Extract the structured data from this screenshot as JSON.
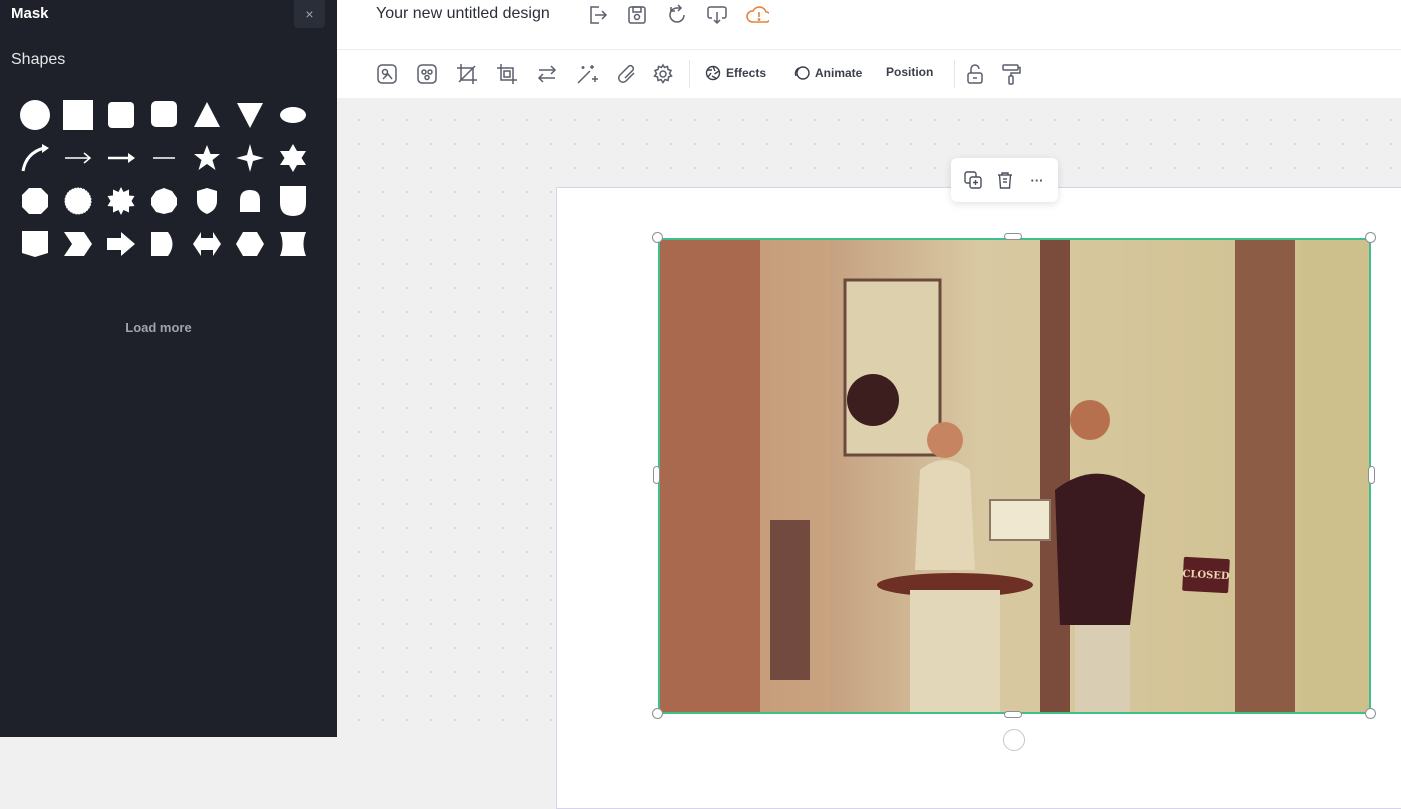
{
  "sidebar": {
    "title": "Mask",
    "close_label": "×",
    "section_title": "Shapes",
    "load_more": "Load more",
    "collapse_icon": "chevron-left-icon"
  },
  "header": {
    "document_title": "Your new untitled design",
    "icons": [
      "export-icon",
      "save-icon",
      "sync-icon",
      "download-icon",
      "cloud-warning-icon"
    ]
  },
  "toolbar": {
    "icons": [
      "shape-edit-icon",
      "adjust-icon",
      "crop-icon",
      "crop-frame-icon",
      "swap-icon",
      "magic-wand-icon",
      "link-icon",
      "settings-icon"
    ],
    "effects_label": "Effects",
    "animate_label": "Animate",
    "position_label": "Position",
    "trailing_icons": [
      "unlock-icon",
      "paint-roller-icon"
    ]
  },
  "floating_menu": {
    "icons": [
      "duplicate-icon",
      "delete-icon",
      "more-icon"
    ],
    "more_label": "···"
  },
  "image": {
    "sign_text": "CLOSED",
    "tint": "#b8a878"
  },
  "colors": {
    "sidebar_bg": "#1e2129",
    "selection": "#3fc08a",
    "cloud_warning": "#e8823a"
  }
}
